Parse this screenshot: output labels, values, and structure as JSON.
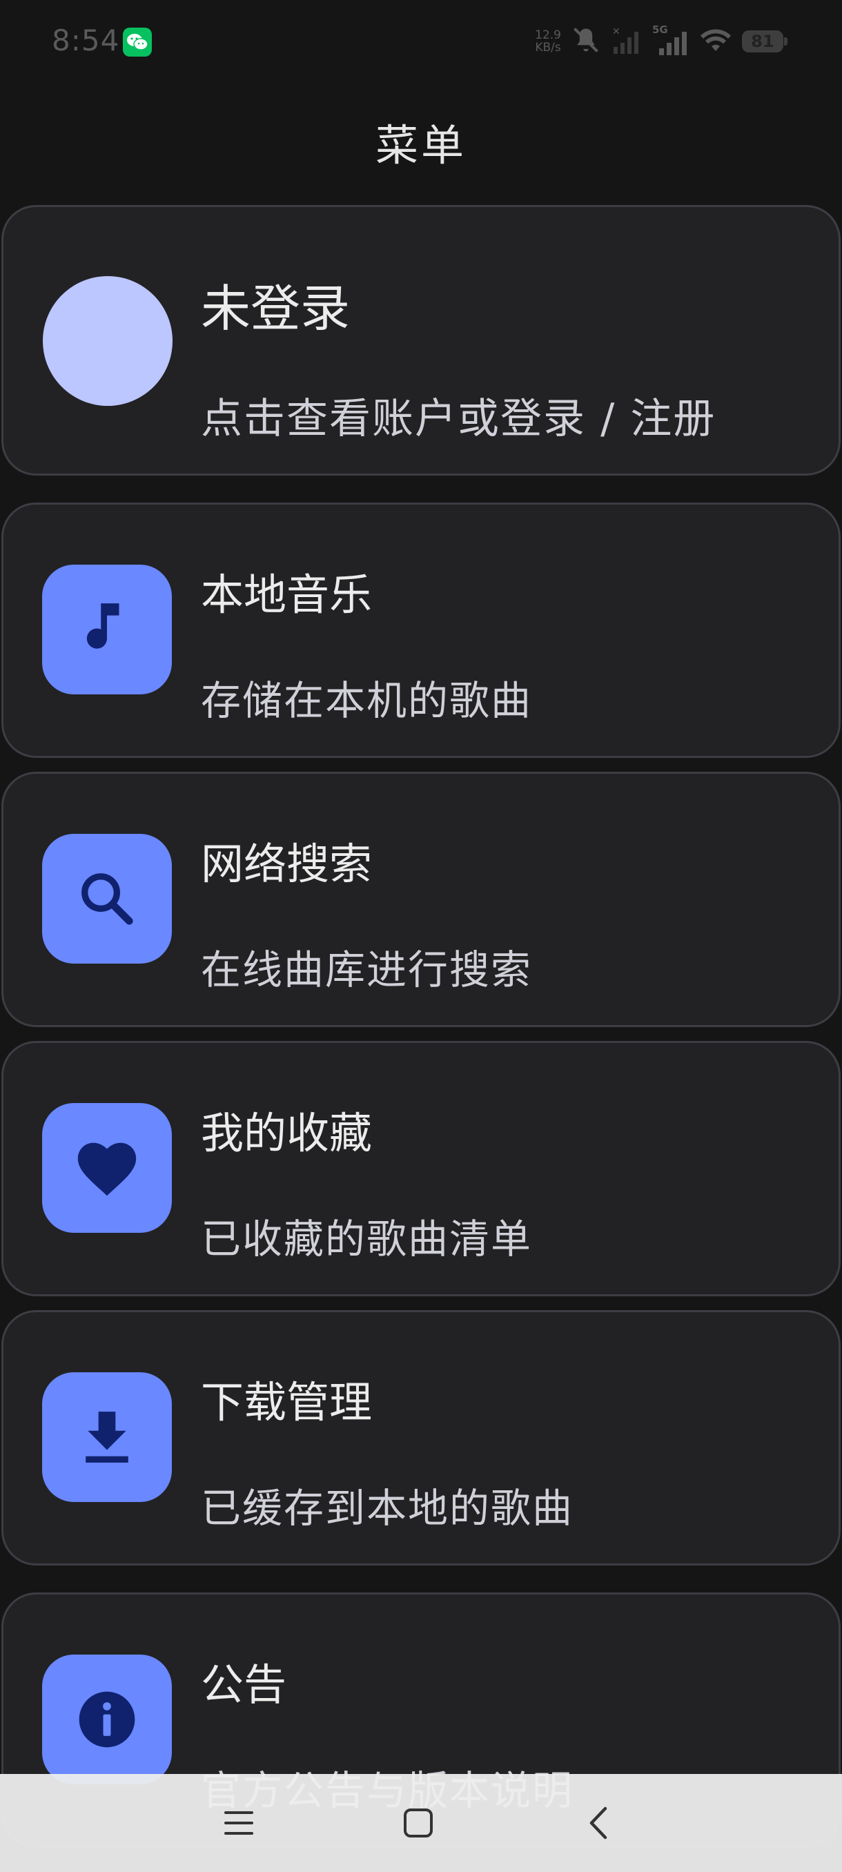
{
  "status_bar": {
    "time": "8:54",
    "net_speed_value": "12.9",
    "net_speed_unit": "KB/s",
    "network_label": "5G",
    "battery": "81",
    "icons": [
      "wechat-icon",
      "mute-icon",
      "signal-icon",
      "signal-5g-icon",
      "wifi-icon",
      "battery-icon"
    ]
  },
  "header": {
    "title": "菜单"
  },
  "account": {
    "title": "未登录",
    "subtitle": "点击查看账户或登录 / 注册"
  },
  "menu": [
    {
      "id": "local-music",
      "title": "本地音乐",
      "subtitle": "存储在本机的歌曲",
      "icon": "music-note-icon"
    },
    {
      "id": "online-search",
      "title": "网络搜索",
      "subtitle": "在线曲库进行搜索",
      "icon": "search-icon"
    },
    {
      "id": "favorites",
      "title": "我的收藏",
      "subtitle": "已收藏的歌曲清单",
      "icon": "heart-icon"
    },
    {
      "id": "downloads",
      "title": "下载管理",
      "subtitle": "已缓存到本地的歌曲",
      "icon": "download-icon"
    },
    {
      "id": "announcements",
      "title": "公告",
      "subtitle": "官方公告与版本说明",
      "icon": "info-icon"
    }
  ],
  "colors": {
    "background": "#151515",
    "card": "#222224",
    "card_border": "#3d3d44",
    "icon_tile": "#6a88ff",
    "icon_glyph": "#10226e",
    "avatar": "#bcc6ff",
    "nav_bar": "#eeeeee"
  },
  "nav_bar": {
    "buttons": [
      "menu-icon",
      "home-icon",
      "back-icon"
    ]
  }
}
